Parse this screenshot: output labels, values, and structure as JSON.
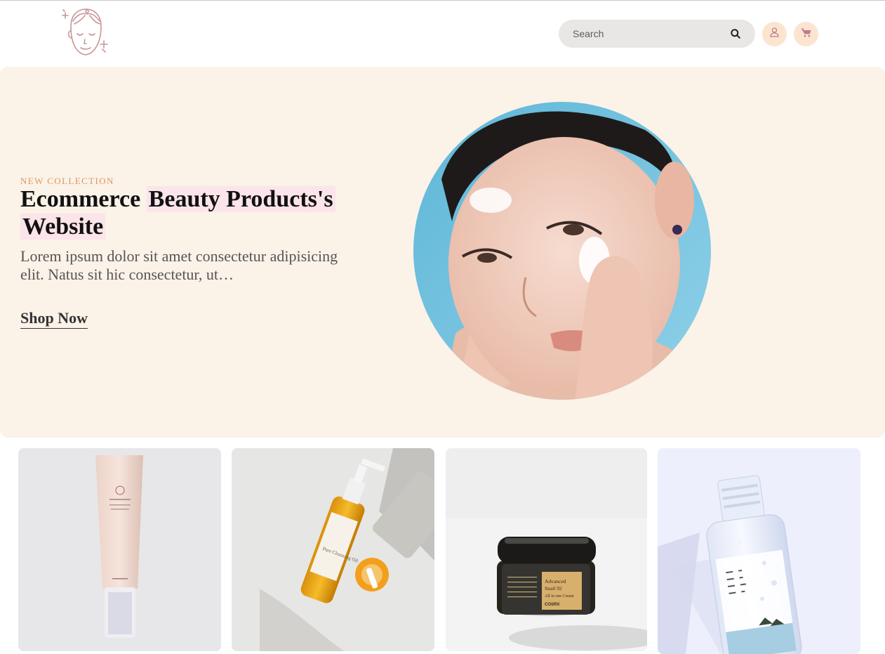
{
  "header": {
    "logo_icon": "face-skincare-logo-icon",
    "search": {
      "placeholder": "Search",
      "icon": "search-icon"
    },
    "user_icon": "user-icon",
    "cart_icon": "cart-icon"
  },
  "hero": {
    "eyebrow": "NEW COLLECTION",
    "title_plain": "Ecommerce",
    "title_highlight_1": "Beauty Products's",
    "title_highlight_2": "Website",
    "description": "Lorem ipsum dolor sit amet consectetur adipisicing elit. Natus sit hic consectetur, ut…",
    "cta": "Shop Now"
  },
  "products": [
    {
      "image": "beauty-of-joseon-sunscreen-tube"
    },
    {
      "image": "manyo-pure-cleansing-oil-bottle"
    },
    {
      "image": "cosrx-advanced-snail-92-cream-jar"
    },
    {
      "image": "round-lab-toner-bottle"
    }
  ],
  "product_labels": {
    "oil": "Pure Cleansing Oil",
    "snail_1": "Advanced",
    "snail_2": "Snail 92",
    "snail_3": "All in one Cream",
    "snail_brand": "COSRX"
  },
  "colors": {
    "hero_bg": "#fbf2e8",
    "accent_peach": "#fbe5d0",
    "accent_icon": "#c07a8a",
    "eyebrow": "#d99a60",
    "highlight": "#fbe4ea"
  }
}
